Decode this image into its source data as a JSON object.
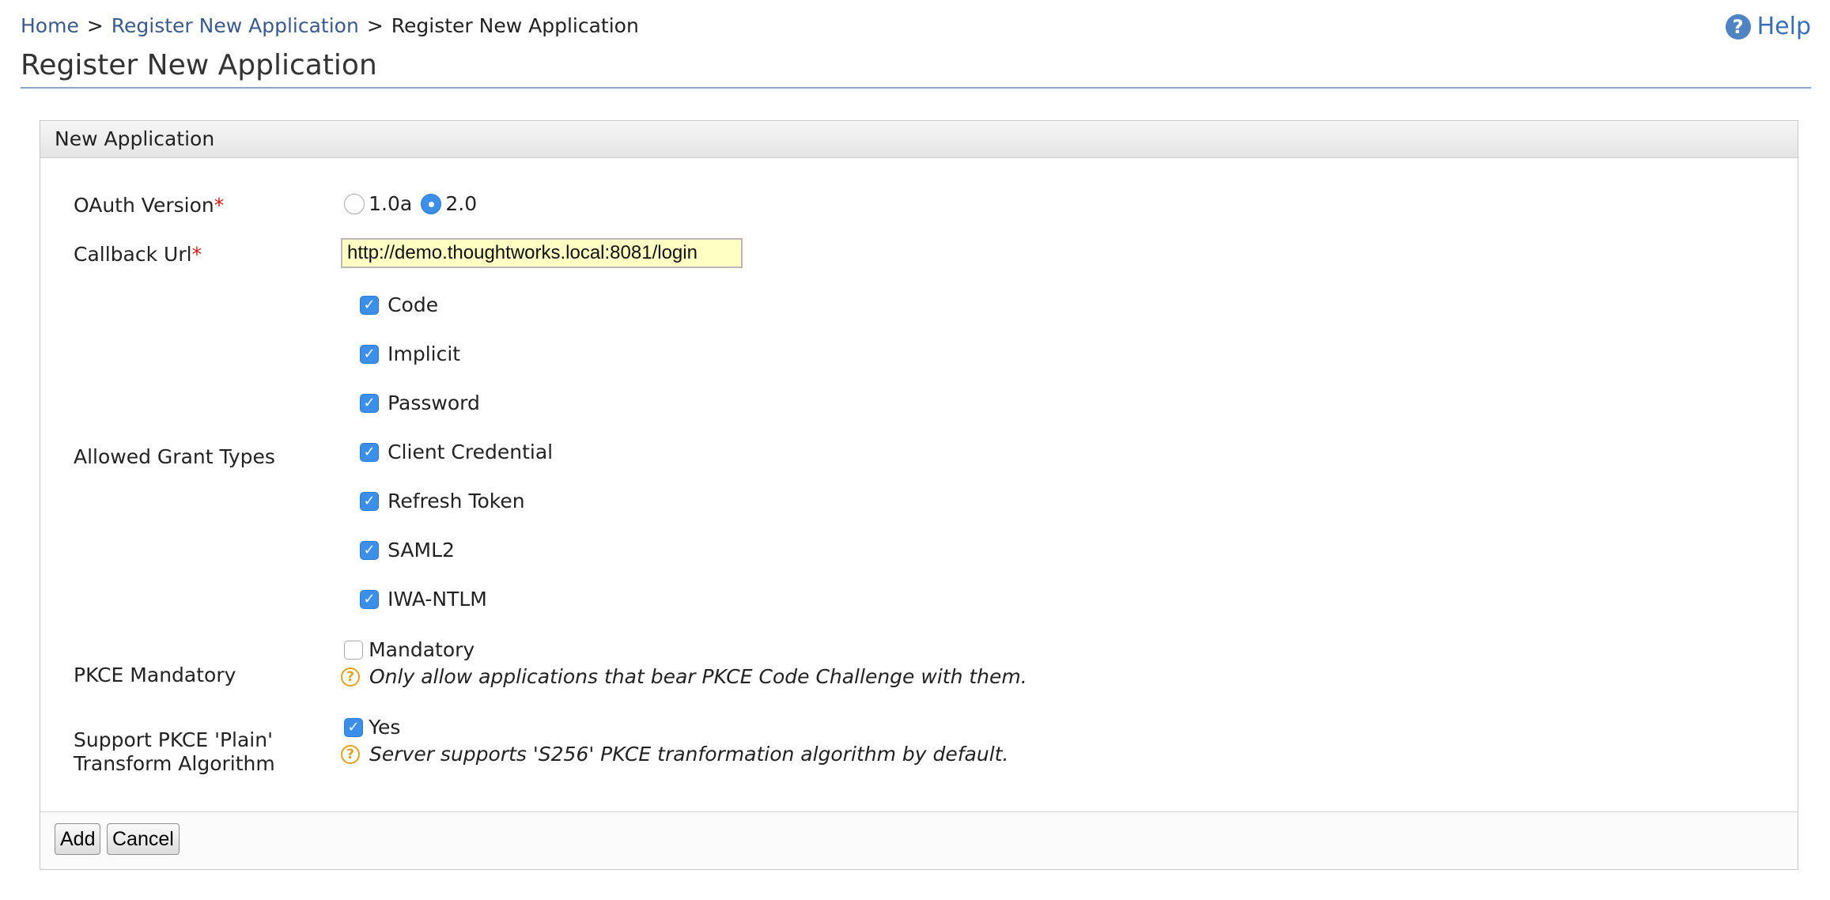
{
  "breadcrumb": {
    "home": "Home",
    "sep1": ">",
    "parent": "Register New Application",
    "sep2": ">",
    "current": "Register New Application"
  },
  "help": {
    "icon": "question-circle-icon",
    "label": "Help"
  },
  "page_title": "Register New Application",
  "panel": {
    "title": "New Application",
    "oauth_version": {
      "label": "OAuth Version",
      "required_mark": "*",
      "options": [
        {
          "label": "1.0a",
          "selected": false
        },
        {
          "label": "2.0",
          "selected": true
        }
      ]
    },
    "callback_url": {
      "label": "Callback Url",
      "required_mark": "*",
      "value": "http://demo.thoughtworks.local:8081/login"
    },
    "grant_types": {
      "label": "Allowed Grant Types",
      "options": [
        {
          "label": "Code",
          "checked": true
        },
        {
          "label": "Implicit",
          "checked": true
        },
        {
          "label": "Password",
          "checked": true
        },
        {
          "label": "Client Credential",
          "checked": true
        },
        {
          "label": "Refresh Token",
          "checked": true
        },
        {
          "label": "SAML2",
          "checked": true
        },
        {
          "label": "IWA-NTLM",
          "checked": true
        }
      ]
    },
    "pkce_mandatory": {
      "label": "PKCE Mandatory",
      "option_label": "Mandatory",
      "checked": false,
      "hint": "Only allow applications that bear PKCE Code Challenge with them."
    },
    "pkce_plain": {
      "label_line1": "Support PKCE 'Plain'",
      "label_line2": "Transform Algorithm",
      "option_label": "Yes",
      "checked": true,
      "hint": "Server supports 'S256' PKCE tranformation algorithm by default."
    },
    "buttons": {
      "add": "Add",
      "cancel": "Cancel"
    }
  },
  "colors": {
    "link": "#3b5a8c",
    "accent": "#3b8fe8",
    "required": "#d21b1b",
    "input_bg": "#ffffc4",
    "hint_icon": "#e0a21a"
  }
}
